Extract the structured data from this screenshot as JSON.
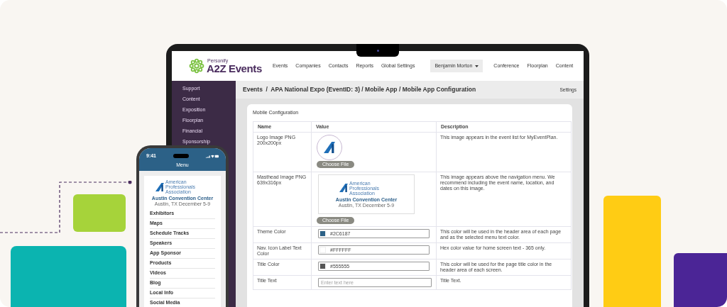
{
  "header": {
    "brand_tagline": "Personify",
    "brand": "A2Z Events",
    "nav_links": [
      "Events",
      "Companies",
      "Contacts",
      "Reports",
      "Global Settings"
    ],
    "user_menu": "Benjamin Morton",
    "right_links": [
      "Conference",
      "Floorplan",
      "Content"
    ]
  },
  "sidebar": {
    "items": [
      "Support",
      "Content",
      "Exposition",
      "Floorplan",
      "Financial",
      "Sponsorship"
    ]
  },
  "breadcrumb": "Events  /  APA National Expo (EventID: 3) / Mobile App / Mobile App Configuration",
  "settings_link": "Settings",
  "card": {
    "title": "Mobile Configuration",
    "columns": [
      "Name",
      "Value",
      "Description"
    ],
    "rows": [
      {
        "kind": "logo",
        "name": "Logo Image PNG 200x200px",
        "button": "Choose File",
        "description": "This image appears in the event list for MyEventPlan."
      },
      {
        "kind": "masthead",
        "name": "Masthead Image PNG 639x316px",
        "org": "American Professionals Association",
        "venue": "Austin Convention Center",
        "dates": "Austin, TX December 5-9",
        "button": "Choose File",
        "description": "This image appears above the navigation menu. We recommend including the event name, location, and dates on this image."
      },
      {
        "kind": "color",
        "name": "Theme Color",
        "value": "#2C6187",
        "color": "#2c6187",
        "description": "This color will be used in the header area of each page and as the selected menu text color."
      },
      {
        "kind": "color",
        "name": "Nav. Icon Label Text Color",
        "value": "#FFFFFF",
        "color": "#ffffff",
        "description": "Hex color value for home screen text - 365 only."
      },
      {
        "kind": "color",
        "name": "Title Color",
        "value": "#555555",
        "color": "#555555",
        "description": "This color will be used for the page title color in the header area of each screen."
      },
      {
        "kind": "text",
        "name": "Title Text",
        "placeholder": "Enter text here",
        "description": "Title Text."
      }
    ]
  },
  "phone": {
    "time": "9:41",
    "title": "Menu",
    "org": "American Professionals Association",
    "venue": "Austin Convention Center",
    "dates": "Austin, TX December 5-9",
    "menu_items": [
      "Exhibitors",
      "Maps",
      "Schedule Tracks",
      "Speakers",
      "App Sponsor",
      "Products",
      "Videos",
      "Blog",
      "Local Info",
      "Social Media"
    ]
  }
}
